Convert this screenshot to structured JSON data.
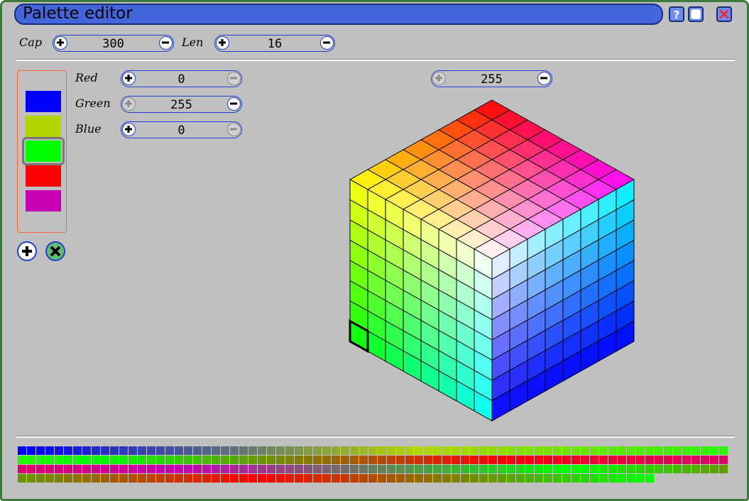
{
  "window": {
    "title": "Palette editor",
    "buttons": [
      "help-icon",
      "maximize-icon",
      "close-icon"
    ],
    "border_color": "#3b7a3b",
    "title_color": "#4466dd"
  },
  "toolbar": {
    "cap_label": "Cap",
    "cap_value": "300",
    "len_label": "Len",
    "len_value": "16"
  },
  "rgb": {
    "red_label": "Red",
    "red_value": "0",
    "green_label": "Green",
    "green_value": "255",
    "blue_label": "Blue",
    "blue_value": "0"
  },
  "slice": {
    "value": "255"
  },
  "palette": {
    "swatches": [
      "#0000ff",
      "#b4d400",
      "#00ff00",
      "#ff0000",
      "#c800b4"
    ],
    "selected_index": 2,
    "actions": [
      "add-icon",
      "delete-icon"
    ]
  },
  "cube": {
    "steps": 8,
    "selected": {
      "r": 0,
      "g": 255,
      "b": 0
    }
  },
  "gradient": {
    "rows": 4,
    "stops": [
      "#0000ff",
      "#b4d400",
      "#00ff00",
      "#ff0000",
      "#c800b4",
      "#00ff00",
      "#ff0000",
      "#00ff00"
    ],
    "total_cells": 300
  }
}
